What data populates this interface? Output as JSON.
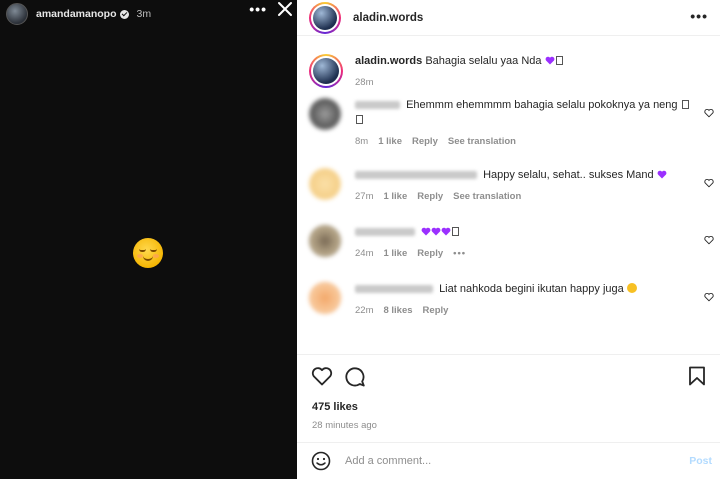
{
  "story": {
    "username": "amandamanopo",
    "time": "3m",
    "more_label": "•••",
    "avatar_icon": "profile-avatar",
    "center_emoji": "smiling-face-icon"
  },
  "post": {
    "username": "aladin.words",
    "more_label": "•••",
    "caption": {
      "username": "aladin.words",
      "text": "Bahagia selalu yaa Nda",
      "time": "28m"
    },
    "comments": [
      {
        "text": "Ehemmm ehemmmm bahagia selalu pokoknya ya neng",
        "time": "8m",
        "likes": "1 like",
        "reply": "Reply",
        "translate": "See translation"
      },
      {
        "text": "Happy selalu, sehat.. sukses Mand",
        "time": "27m",
        "likes": "1 like",
        "reply": "Reply",
        "translate": "See translation"
      },
      {
        "text": "",
        "time": "24m",
        "likes": "1 like",
        "reply": "Reply",
        "more": "•••"
      },
      {
        "text": "Liat nahkoda begini ikutan happy juga",
        "time": "22m",
        "likes": "8 likes",
        "reply": "Reply"
      }
    ],
    "likes_count": "475 likes",
    "posted_ago": "28 minutes ago",
    "comment_input": {
      "placeholder": "Add a comment...",
      "value": ""
    },
    "post_button": "Post"
  },
  "colors": {
    "story_bg": "#0d0d0d",
    "purple_heart": "#9b30ff",
    "post_button_disabled": "#b3dbff",
    "muted_text": "#8e8e8e"
  }
}
